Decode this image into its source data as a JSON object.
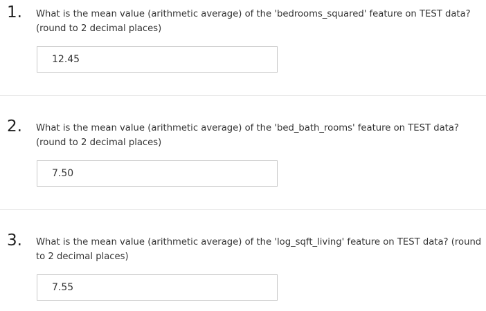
{
  "questions": [
    {
      "number": "1.",
      "text": "What is the mean value (arithmetic average) of the 'bedrooms_squared' feature on TEST data? (round to 2 decimal places)",
      "answer": "12.45"
    },
    {
      "number": "2.",
      "text": "What is the mean value (arithmetic average) of the 'bed_bath_rooms' feature on TEST data? (round to 2 decimal places)",
      "answer": "7.50"
    },
    {
      "number": "3.",
      "text": "What is the mean value (arithmetic average) of the 'log_sqft_living' feature on TEST data? (round to 2 decimal places)",
      "answer": "7.55"
    }
  ]
}
